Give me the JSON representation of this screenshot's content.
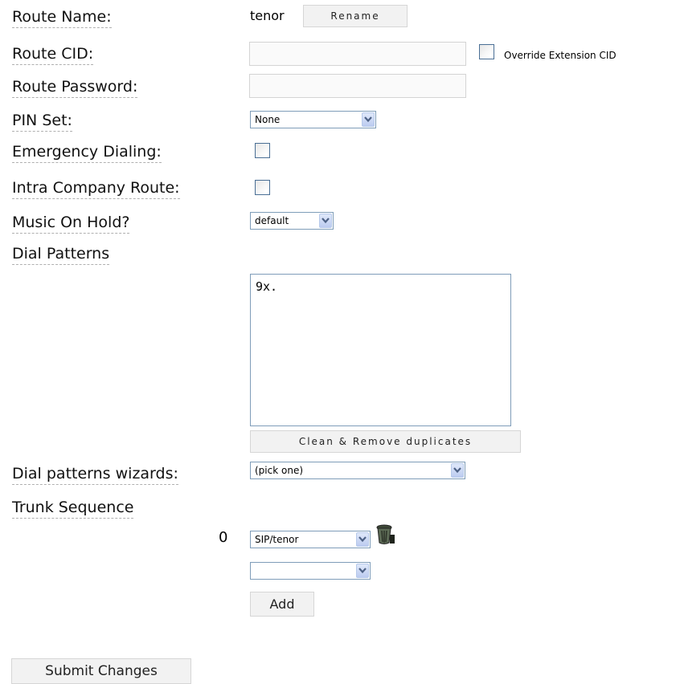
{
  "labels": {
    "route_name": "Route Name:",
    "route_cid": "Route CID:",
    "route_password": "Route Password:",
    "pin_set": "PIN Set:",
    "emergency_dialing": "Emergency Dialing:",
    "intra_company_route": "Intra Company Route:",
    "music_on_hold": "Music On Hold?",
    "dial_patterns": "Dial Patterns",
    "dial_patterns_wizards": "Dial patterns wizards:",
    "trunk_sequence": "Trunk Sequence"
  },
  "route_name": {
    "value": "tenor",
    "rename_button": "Rename"
  },
  "route_cid": {
    "value": "",
    "override_label": "Override Extension CID",
    "override_checked": false
  },
  "route_password": {
    "value": ""
  },
  "pin_set": {
    "selected": "None"
  },
  "emergency_dialing": {
    "checked": false
  },
  "intra_company_route": {
    "checked": false
  },
  "music_on_hold": {
    "selected": "default"
  },
  "dial_patterns": {
    "value": "9x.",
    "clean_button": "Clean & Remove duplicates"
  },
  "dial_patterns_wizards": {
    "selected": "(pick one)"
  },
  "trunk_sequence": {
    "rows": [
      {
        "index": "0",
        "selected": "SIP/tenor",
        "icon": "trash-can-icon"
      }
    ],
    "new_row_selected": "",
    "add_button": "Add"
  },
  "submit_button": "Submit Changes",
  "colors": {
    "select_border": "#7f9db9",
    "checkbox_border": "#4a6f95",
    "button_bg": "#f2f2f2"
  }
}
